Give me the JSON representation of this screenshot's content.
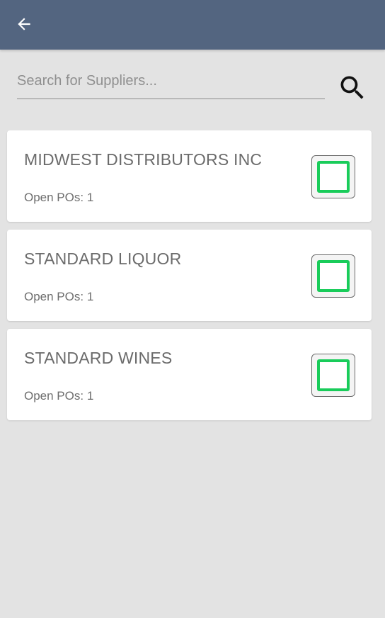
{
  "header": {
    "back_icon": "arrow-left-icon",
    "bar_color": "#536580"
  },
  "search": {
    "placeholder": "Search for Suppliers...",
    "value": "",
    "icon": "search-icon"
  },
  "suppliers": [
    {
      "name": "MIDWEST DISTRIBUTORS INC",
      "open_pos": "Open POs: 1"
    },
    {
      "name": "STANDARD LIQUOR",
      "open_pos": "Open POs: 1"
    },
    {
      "name": "STANDARD WINES",
      "open_pos": "Open POs: 1"
    }
  ],
  "colors": {
    "background": "#e3e3e3",
    "card": "#ffffff",
    "accent_green": "#19cc5a"
  }
}
